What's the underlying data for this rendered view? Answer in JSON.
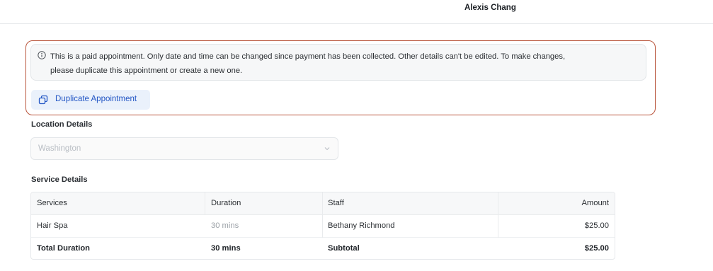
{
  "header": {
    "user_name": "Alexis Chang"
  },
  "notice": {
    "icon": "info-circle-icon",
    "line1": "This is a paid appointment. Only date and time can be changed since payment has been collected. Other details can't be edited. To make changes,",
    "line2": "please duplicate this appointment or create a new one."
  },
  "actions": {
    "duplicate_label": "Duplicate Appointment",
    "duplicate_icon": "copy-icon"
  },
  "location": {
    "title": "Location Details",
    "value": "Washington"
  },
  "services": {
    "title": "Service Details",
    "columns": [
      "Services",
      "Duration",
      "Staff",
      "Amount"
    ],
    "rows": [
      [
        "Hair Spa",
        "30 mins",
        "Bethany Richmond",
        "$25.00"
      ]
    ],
    "footer": [
      "Total Duration",
      "30 mins",
      "Subtotal",
      "$25.00"
    ]
  },
  "colors": {
    "highlight_border": "#b9553c",
    "accent": "#2457c5",
    "accent_bg": "#eaf1fb"
  }
}
